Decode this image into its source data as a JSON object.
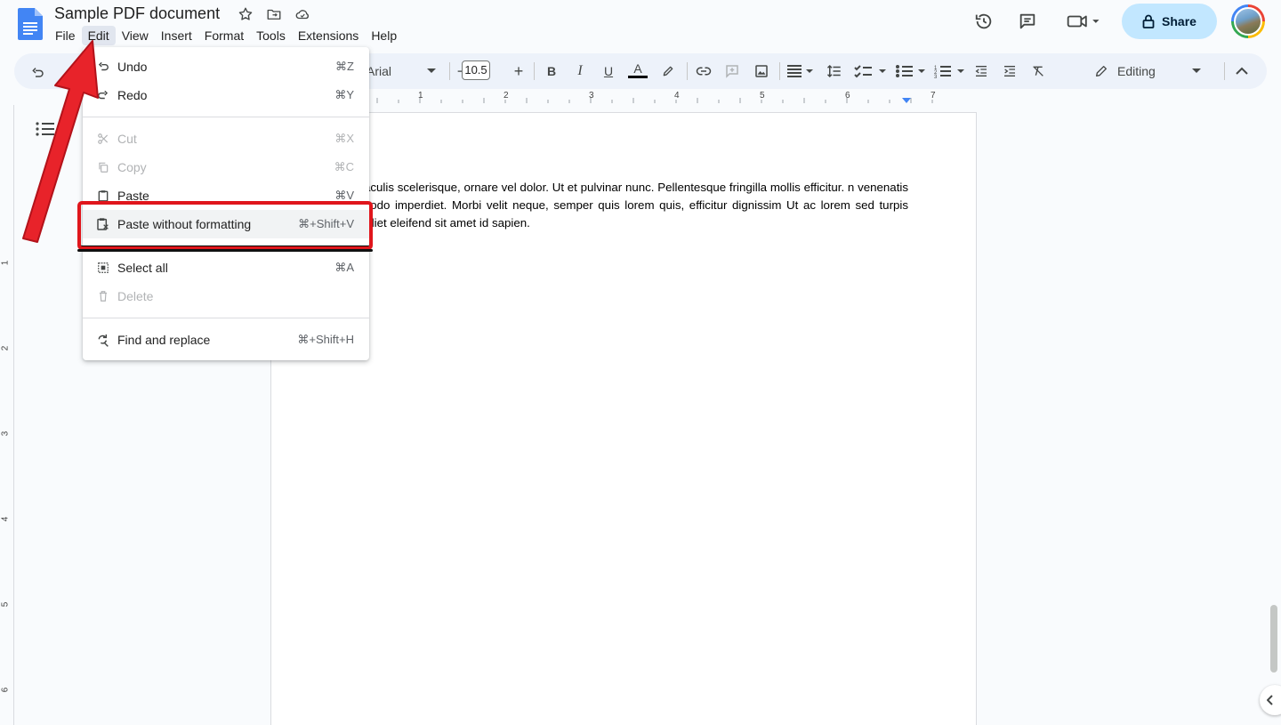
{
  "header": {
    "title": "Sample PDF document",
    "share_label": "Share"
  },
  "menubar": [
    "File",
    "Edit",
    "View",
    "Insert",
    "Format",
    "Tools",
    "Extensions",
    "Help"
  ],
  "toolbar": {
    "font": "Arial",
    "font_size": "10.5",
    "mode": "Editing"
  },
  "ruler": [
    "1",
    "2",
    "3",
    "4",
    "5",
    "6",
    "7"
  ],
  "vruler": [
    "1",
    "2",
    "3",
    "4",
    "5",
    "6"
  ],
  "edit_menu": {
    "undo": {
      "label": "Undo",
      "shortcut": "⌘Z"
    },
    "redo": {
      "label": "Redo",
      "shortcut": "⌘Y"
    },
    "cut": {
      "label": "Cut",
      "shortcut": "⌘X"
    },
    "copy": {
      "label": "Copy",
      "shortcut": "⌘C"
    },
    "paste": {
      "label": "Paste",
      "shortcut": "⌘V"
    },
    "paste_plain": {
      "label": "Paste without formatting",
      "shortcut": "⌘+Shift+V"
    },
    "select_all": {
      "label": "Select all",
      "shortcut": "⌘A"
    },
    "delete": {
      "label": "Delete"
    },
    "find_replace": {
      "label": "Find and replace",
      "shortcut": "⌘+Shift+H"
    }
  },
  "document": {
    "text": "a at iaculis scelerisque, ornare vel dolor. Ut et pulvinar nunc. Pellentesque fringilla mollis efficitur. n venenatis commodo imperdiet. Morbi velit neque, semper quis lorem quis, efficitur dignissim Ut ac lorem sed turpis imperdiet eleifend sit amet id sapien."
  },
  "colors": {
    "accent": "#c2e7ff",
    "highlight": "#e0161c",
    "arrow": "#e8232a"
  }
}
